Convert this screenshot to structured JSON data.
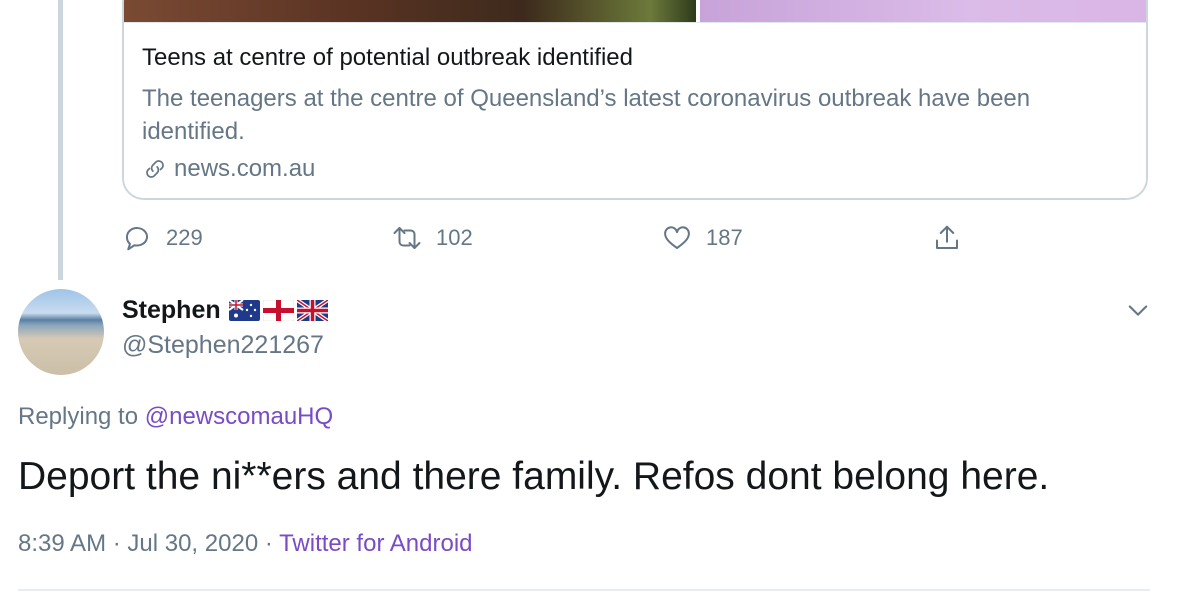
{
  "card": {
    "title": "Teens at centre of potential outbreak identified",
    "description": "The teenagers at the centre of Queensland’s latest coronavirus outbreak have been identified.",
    "domain": "news.com.au"
  },
  "actions": {
    "reply_count": "229",
    "retweet_count": "102",
    "like_count": "187"
  },
  "tweet": {
    "display_name": "Stephen",
    "flags": [
      "australia-flag",
      "england-flag",
      "uk-flag"
    ],
    "handle": "@Stephen221267",
    "replying_prefix": "Replying to ",
    "replying_to": "@newscomauHQ",
    "text": "Deport the ni**ers and there family. Refos dont belong here.",
    "time": "8:39 AM",
    "separator": " · ",
    "date": "Jul 30, 2020",
    "source": "Twitter for Android"
  },
  "colors": {
    "accent": "#794bc4",
    "muted": "#657786",
    "border": "#ccd6dd"
  }
}
